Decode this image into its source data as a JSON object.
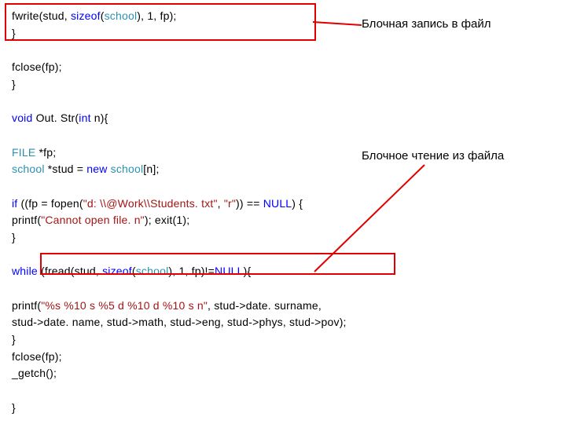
{
  "code": {
    "l1a": "fwrite(stud, ",
    "l1b": "sizeof",
    "l1c": "(",
    "l1d": "school",
    "l1e": "), 1, fp);",
    "l2": "}",
    "l3": "",
    "l4": "fclose(fp);",
    "l5": "}",
    "l6": "",
    "l7a": "void",
    "l7b": " Out. Str(",
    "l7c": "int",
    "l7d": " n){",
    "l8": "",
    "l9a": "FILE",
    "l9b": " *fp;",
    "l10a": "school",
    "l10b": " *stud = ",
    "l10c": "new",
    "l10d": " ",
    "l10e": "school",
    "l10f": "[n];",
    "l11": "",
    "l12a": "if",
    "l12b": " ((fp = fopen(",
    "l12c": "\"d: \\\\@Work\\\\Students. txt\"",
    "l12d": ", ",
    "l12e": "\"r\"",
    "l12f": ")) == ",
    "l12g": "NULL",
    "l12h": ") {",
    "l13a": "printf(",
    "l13b": "\"Cannot open file. n\"",
    "l13c": "); exit(1);",
    "l14": "}",
    "l15": "",
    "l16a": "while",
    "l16b": " (fread(stud, ",
    "l16c": "sizeof",
    "l16d": "(",
    "l16e": "school",
    "l16f": "), 1, fp)!=",
    "l16g": "NULL",
    "l16h": "){",
    "l17": "",
    "l18a": "printf(",
    "l18b": "\"%s %10 s %5 d %10 d %10 s n\"",
    "l18c": ", stud->date. surname,",
    "l19": "stud->date. name, stud->math, stud->eng, stud->phys, stud->pov);",
    "l20": "}",
    "l21": "fclose(fp);",
    "l22": "_getch();",
    "l23": "",
    "l24": "}"
  },
  "annotations": {
    "write": "Блочная запись в файл",
    "read": "Блочное чтение из файла"
  }
}
